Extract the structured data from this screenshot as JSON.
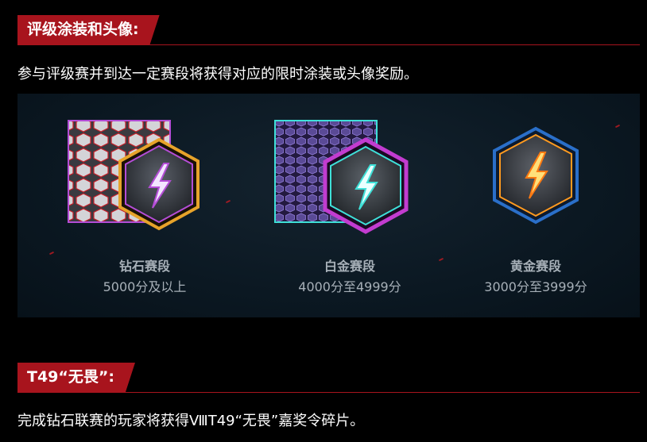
{
  "section1": {
    "title": "评级涂装和头像:",
    "description": "参与评级赛并到达一定赛段将获得对应的限时涂装或头像奖励。"
  },
  "tiers": [
    {
      "name": "钻石赛段",
      "range": "5000分及以上",
      "icon": "diamond-tier-lightning-icon",
      "accent": "#b44dd6",
      "frame": "#e7a32a"
    },
    {
      "name": "白金赛段",
      "range": "4000分至4999分",
      "icon": "platinum-tier-lightning-icon",
      "accent": "#3fe0d8",
      "frame": "#c23cd0"
    },
    {
      "name": "黄金赛段",
      "range": "3000分至3999分",
      "icon": "gold-tier-lightning-icon",
      "accent": "#ff9a1f",
      "frame": "#2a6fc9"
    }
  ],
  "section2": {
    "title": "T49“无畏”:",
    "description": "完成钻石联赛的玩家将获得ⅧT49“无畏”嘉奖令碎片。"
  },
  "colors": {
    "accent_red": "#a8141d",
    "panel_bg": "#0b1822",
    "muted_text": "#a7b0b8"
  }
}
